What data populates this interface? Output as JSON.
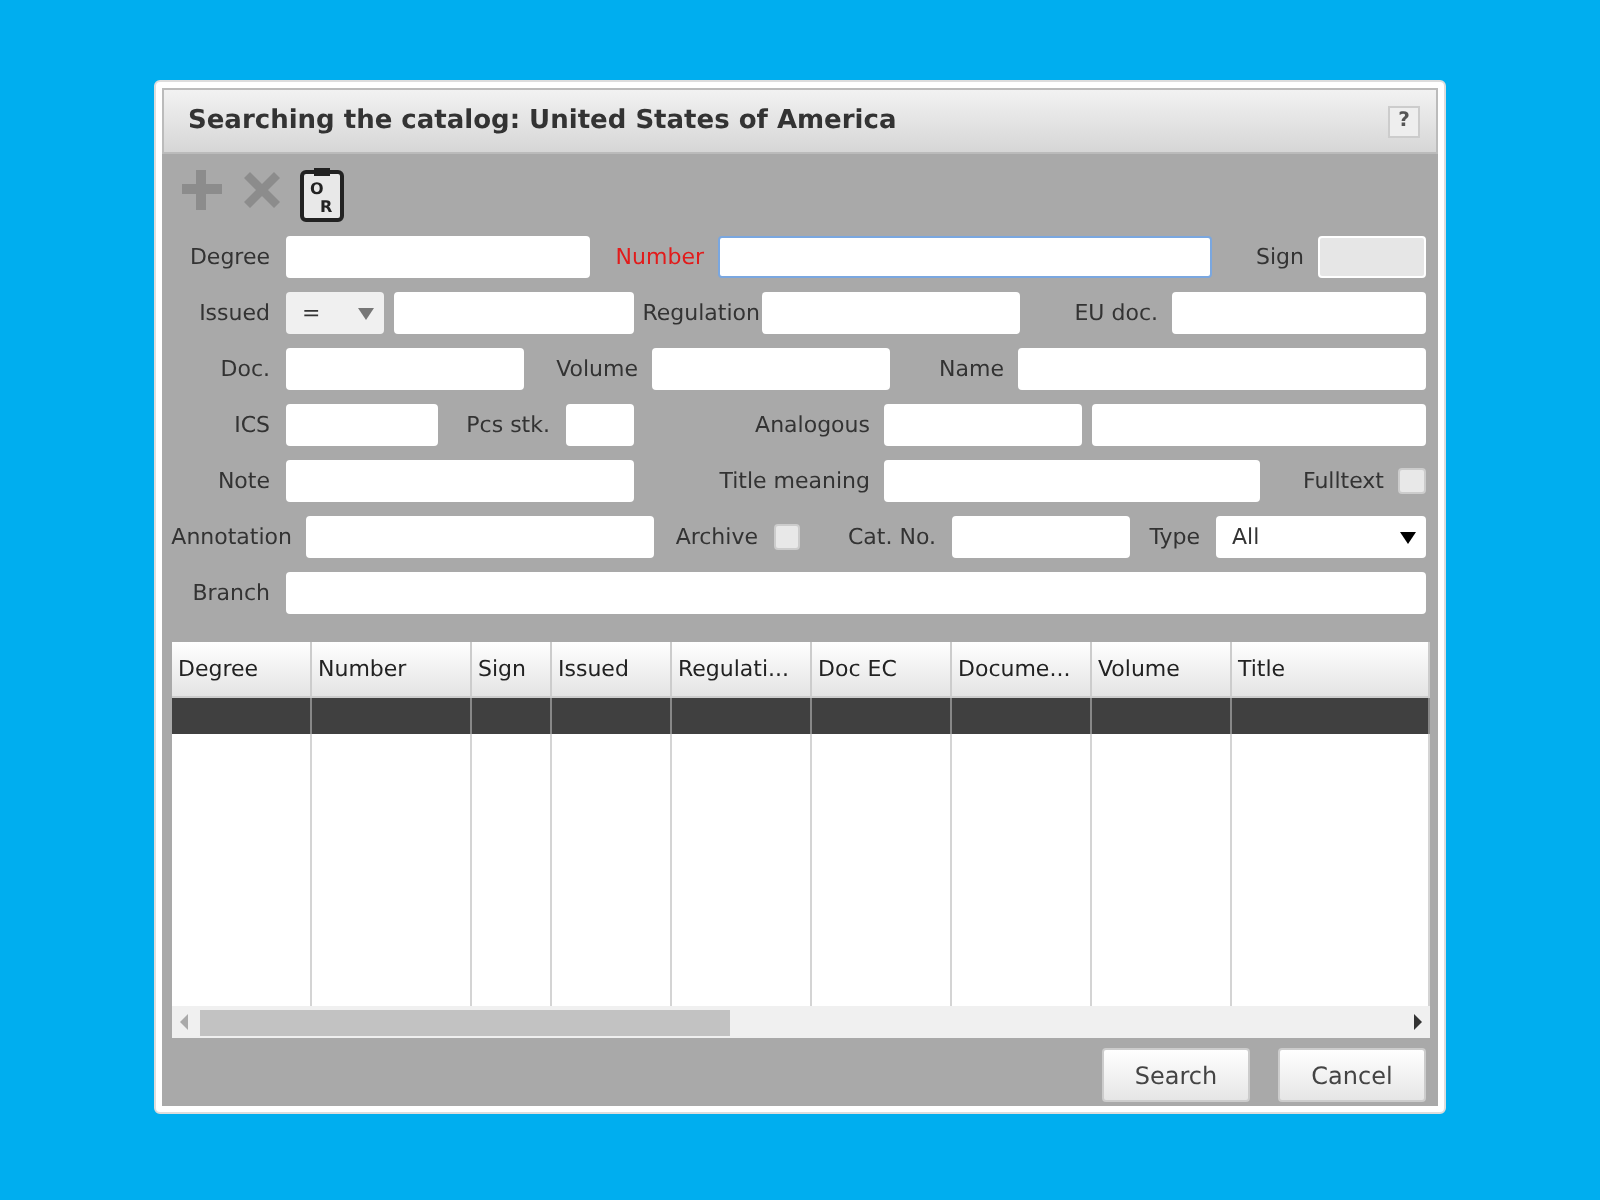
{
  "window": {
    "title": "Searching the catalog: United States of America",
    "help": "?"
  },
  "toolbar": [
    {
      "kind": "add",
      "disabled": true
    },
    {
      "kind": "tools",
      "disabled": true
    },
    {
      "kind": "clipboard",
      "disabled": false,
      "letters": [
        "O",
        "R"
      ]
    }
  ],
  "form_rows": [
    [
      {
        "kind": "label",
        "text": "Degree"
      },
      {
        "kind": "field"
      },
      {
        "kind": "label",
        "text": "Number",
        "required": true
      },
      {
        "kind": "field",
        "focused": true
      },
      {
        "kind": "label",
        "text": "Sign"
      },
      {
        "kind": "field",
        "disabled": true
      }
    ],
    [
      {
        "kind": "label",
        "text": "Issued"
      },
      {
        "kind": "select",
        "value": "="
      },
      {
        "kind": "field"
      },
      {
        "kind": "label",
        "text": "Regulation"
      },
      {
        "kind": "field"
      },
      {
        "kind": "label",
        "text": "EU doc."
      },
      {
        "kind": "field"
      }
    ],
    [
      {
        "kind": "label",
        "text": "Doc."
      },
      {
        "kind": "field"
      },
      {
        "kind": "label",
        "text": "Volume"
      },
      {
        "kind": "field"
      },
      {
        "kind": "label",
        "text": "Name"
      },
      {
        "kind": "field"
      }
    ],
    [
      {
        "kind": "label",
        "text": "ICS"
      },
      {
        "kind": "field"
      },
      {
        "kind": "label",
        "text": "Pcs stk."
      },
      {
        "kind": "field"
      },
      {
        "kind": "label",
        "text": "Analogous"
      },
      {
        "kind": "field"
      },
      {
        "kind": "field"
      }
    ],
    [
      {
        "kind": "label",
        "text": "Note"
      },
      {
        "kind": "field"
      },
      {
        "kind": "label",
        "text": "Title meaning"
      },
      {
        "kind": "field"
      },
      {
        "kind": "label",
        "text": "Fulltext"
      },
      {
        "kind": "checkbox",
        "checked": false
      }
    ],
    [
      {
        "kind": "label",
        "text": "Annotation"
      },
      {
        "kind": "field"
      },
      {
        "kind": "label",
        "text": "Archive"
      },
      {
        "kind": "checkbox",
        "checked": false
      },
      {
        "kind": "label",
        "text": "Cat. No."
      },
      {
        "kind": "field"
      },
      {
        "kind": "label",
        "text": "Type"
      },
      {
        "kind": "select",
        "value": "All"
      }
    ],
    [
      {
        "kind": "label",
        "text": "Branch"
      },
      {
        "kind": "field"
      }
    ]
  ],
  "table": {
    "columns": [
      "Degree",
      "Number",
      "Sign",
      "Issued",
      "Regulati...",
      "Doc EC",
      "Docume...",
      "Volume",
      "Title"
    ],
    "rows": [
      {
        "selected": true
      }
    ]
  },
  "buttons": [
    "Search",
    "Cancel"
  ]
}
